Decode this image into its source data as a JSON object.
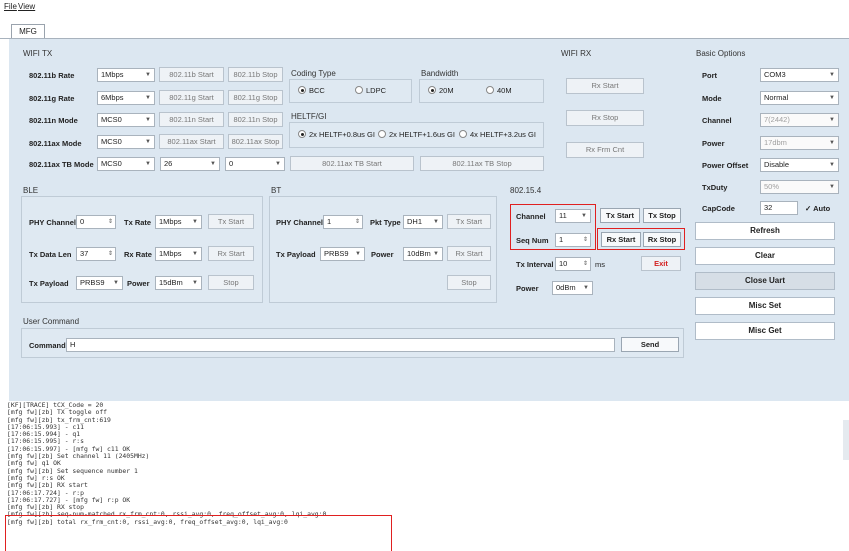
{
  "menu": {
    "file": "File",
    "view": "View"
  },
  "tab": {
    "label": "MFG"
  },
  "wifi_tx": {
    "title": "WIFI TX",
    "rows": [
      {
        "label": "802.11b Rate",
        "value": "1Mbps",
        "start": "802.11b Start",
        "stop": "802.11b Stop"
      },
      {
        "label": "802.11g Rate",
        "value": "6Mbps",
        "start": "802.11g Start",
        "stop": "802.11g Stop"
      },
      {
        "label": "802.11n Mode",
        "value": "MCS0",
        "start": "802.11n Start",
        "stop": "802.11n Stop"
      },
      {
        "label": "802.11ax Mode",
        "value": "MCS0",
        "start": "802.11ax Start",
        "stop": "802.11ax Stop"
      },
      {
        "label": "802.11ax TB Mode",
        "value": "MCS0",
        "value2": "26",
        "value3": "0",
        "start": "802.11ax TB Start",
        "stop": "802.11ax TB Stop"
      }
    ],
    "coding_type": {
      "title": "Coding Type",
      "bcc": "BCC",
      "ldpc": "LDPC"
    },
    "bandwidth": {
      "title": "Bandwidth",
      "bw20": "20M",
      "bw40": "40M"
    },
    "heltf": {
      "title": "HELTF/GI",
      "opt1": "2x HELTF+0.8us GI",
      "opt2": "2x HELTF+1.6us GI",
      "opt3": "4x HELTF+3.2us GI"
    }
  },
  "wifi_rx": {
    "title": "WIFI RX",
    "rx_start": "Rx Start",
    "rx_stop": "Rx Stop",
    "rx_frm_cnt": "Rx Frm Cnt"
  },
  "basic": {
    "title": "Basic Options",
    "port_label": "Port",
    "port": "COM3",
    "mode_label": "Mode",
    "mode": "Normal",
    "channel_label": "Channel",
    "channel": "7(2442)",
    "power_label": "Power",
    "power": "17dbm",
    "power_offset_label": "Power Offset",
    "power_offset": "Disable",
    "txduty_label": "TxDuty",
    "txduty": "50%",
    "capcode_label": "CapCode",
    "capcode": "32",
    "auto": "Auto"
  },
  "right_buttons": {
    "refresh": "Refresh",
    "clear": "Clear",
    "close_uart": "Close Uart",
    "misc_set": "Misc Set",
    "misc_get": "Misc Get"
  },
  "ble": {
    "title": "BLE",
    "phy_channel_label": "PHY Channel",
    "phy_channel": "0",
    "tx_rate_label": "Tx Rate",
    "tx_rate": "1Mbps",
    "tx_start": "Tx Start",
    "tx_data_len_label": "Tx Data Len",
    "tx_data_len": "37",
    "rx_rate_label": "Rx Rate",
    "rx_rate": "1Mbps",
    "rx_start": "Rx Start",
    "tx_payload_label": "Tx Payload",
    "tx_payload": "PRBS9",
    "power_label": "Power",
    "power": "15dBm",
    "stop": "Stop"
  },
  "bt": {
    "title": "BT",
    "phy_channel_label": "PHY Channel",
    "phy_channel": "1",
    "pkt_type_label": "Pkt Type",
    "pkt_type": "DH1",
    "tx_start": "Tx Start",
    "tx_payload_label": "Tx Payload",
    "tx_payload": "PRBS9",
    "power_label": "Power",
    "power": "10dBm",
    "rx_start": "Rx Start",
    "stop": "Stop"
  },
  "zb": {
    "title": "802.15.4",
    "channel_label": "Channel",
    "channel": "11",
    "tx_start": "Tx Start",
    "tx_stop": "Tx Stop",
    "seq_num_label": "Seq Num",
    "seq_num": "1",
    "rx_start": "Rx Start",
    "rx_stop": "Rx Stop",
    "tx_interval_label": "Tx Interval",
    "tx_interval": "10",
    "ms": "ms",
    "exit": "Exit",
    "power_label": "Power",
    "power": "0dBm"
  },
  "user_command": {
    "title": "User Command",
    "label": "Command",
    "value": "H",
    "send": "Send"
  },
  "log": [
    "[KF][TRACE] tCX_Code = 20",
    "[mfg fw][zb] TX toggle off",
    "[mfg fw][zb] tx_frm_cnt:619",
    "[17:06:15.993] - c11",
    "[17:06:15.994] - q1",
    "[17:06:15.995] - r:s",
    "[17:06:15.997] - [mfg fw] c11 OK",
    "[mfg fw][zb] Set channel 11 (2405MHz)",
    "[mfg fw] q1 OK",
    "[mfg fw][zb] Set sequence number 1",
    "[mfg fw] r:s OK",
    "[mfg fw][zb] RX start",
    "[17:06:17.724] - r:p",
    "[17:06:17.727] - [mfg fw] r:p OK",
    "[mfg fw][zb] RX stop",
    "[mfg fw][zb] seq-num-matched rx_frm_cnt:0, rssi_avg:0, freq_offset_avg:0, lqi_avg:0",
    "[mfg fw][zb] total rx_frm_cnt:0, rssi_avg:0, freq_offset_avg:0, lqi_avg:0"
  ]
}
